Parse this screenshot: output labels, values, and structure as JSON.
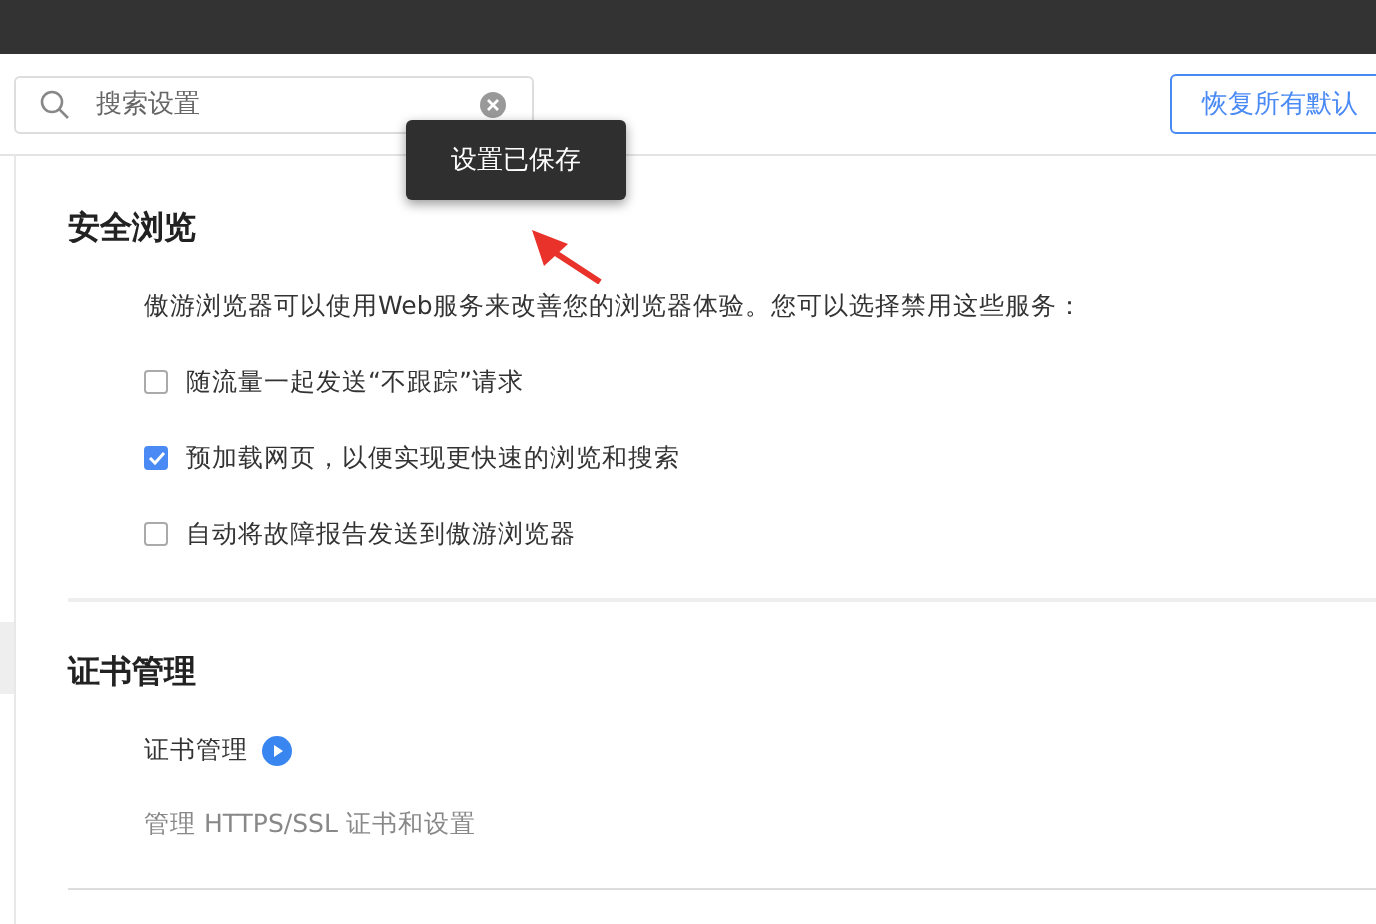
{
  "search": {
    "placeholder": "搜索设置"
  },
  "restore_button": "恢复所有默认",
  "toast": "设置已保存",
  "sections": [
    {
      "title": "安全浏览",
      "description": "傲游浏览器可以使用Web服务来改善您的浏览器体验。您可以选择禁用这些服务：",
      "options": [
        {
          "label": "随流量一起发送“不跟踪”请求",
          "checked": false
        },
        {
          "label": "预加载网页，以便实现更快速的浏览和搜索",
          "checked": true
        },
        {
          "label": "自动将故障报告发送到傲游浏览器",
          "checked": false
        }
      ]
    },
    {
      "title": "证书管理",
      "link": "证书管理",
      "note": "管理 HTTPS/SSL 证书和设置"
    }
  ]
}
